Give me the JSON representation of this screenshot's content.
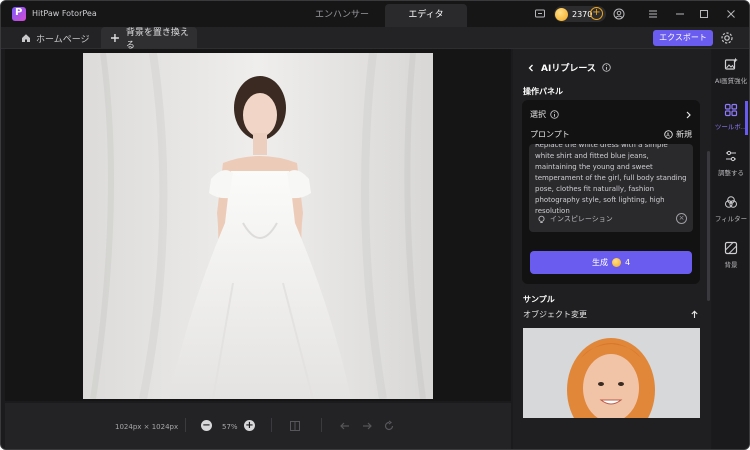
{
  "app": {
    "title": "HitPaw FotorPea"
  },
  "mode_tabs": [
    {
      "label": "エンハンサー",
      "active": false
    },
    {
      "label": "エディタ",
      "active": true
    }
  ],
  "credits": {
    "count": "2370"
  },
  "toolbar": {
    "home_label": "ホームページ",
    "replace_tab_label": "背景を置き換える",
    "export_label": "エクスポート"
  },
  "bottom_bar": {
    "dimensions": "1024px × 1024px",
    "zoom": "57%"
  },
  "panel": {
    "header": "AIリプレース",
    "section_title": "操作パネル",
    "select_label": "選択",
    "prompt_label": "プロンプト",
    "new_label": "新規",
    "prompt_text": "Replace the white dress with a simple white shirt and fitted blue jeans, maintaining the young and sweet temperament of the girl, full body standing pose, clothes fit naturally, fashion photography style, soft lighting, high resolution",
    "inspiration_label": "インスピレーション",
    "generate_label": "生成",
    "generate_cost": "4",
    "sample_section": "サンプル",
    "sample_label": "オブジェクト変更"
  },
  "rail": [
    {
      "label": "AI画質強化",
      "active": false,
      "icon": "image-sparkle-icon"
    },
    {
      "label": "ツールボ...",
      "active": true,
      "icon": "grid-icon"
    },
    {
      "label": "調整する",
      "active": false,
      "icon": "sliders-icon"
    },
    {
      "label": "フィルター",
      "active": false,
      "icon": "filter-icon"
    },
    {
      "label": "背景",
      "active": false,
      "icon": "background-icon"
    }
  ],
  "colors": {
    "accent": "#6b5cf0",
    "coin": "#f2a81b"
  }
}
